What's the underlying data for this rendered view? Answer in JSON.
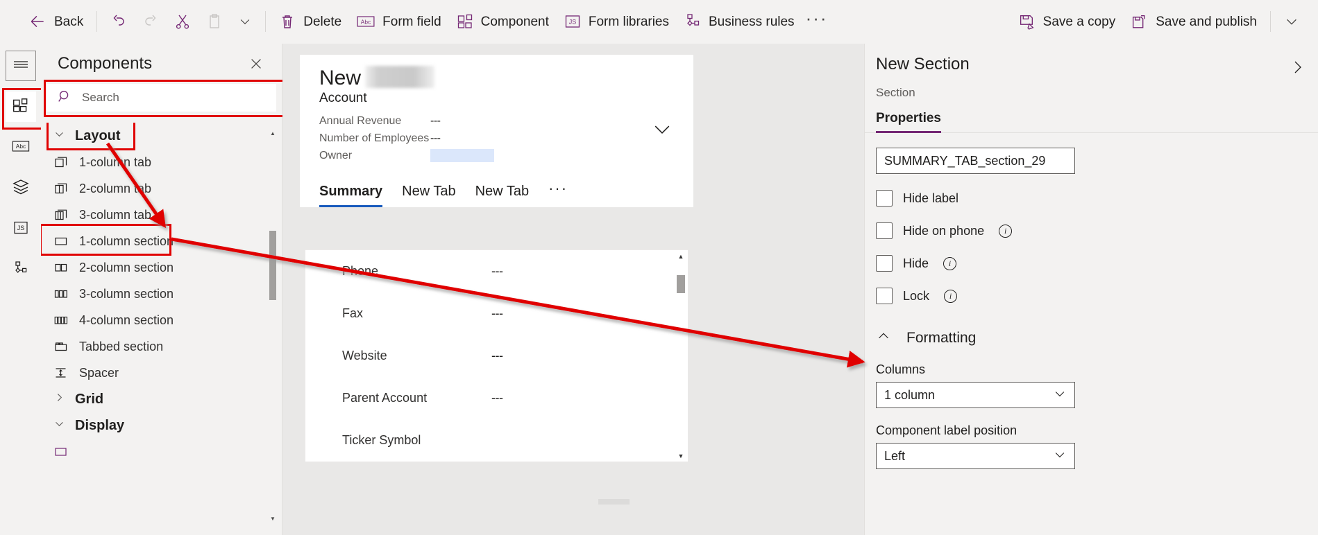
{
  "commandbar": {
    "back_label": "Back",
    "undo_icon": "undo-icon",
    "redo_icon": "redo-icon",
    "cut_icon": "cut-icon",
    "paste_icon": "paste-icon",
    "paste_chevron_icon": "chevron-down-icon",
    "delete_label": "Delete",
    "form_field_label": "Form field",
    "component_label": "Component",
    "form_libraries_label": "Form libraries",
    "business_rules_label": "Business rules",
    "overflow_label": "···",
    "save_a_copy_label": "Save a copy",
    "save_and_publish_label": "Save and publish",
    "save_chevron_icon": "chevron-down-icon"
  },
  "rail": {
    "items": [
      {
        "name": "hamburger-menu-icon",
        "label": ""
      },
      {
        "name": "components-icon",
        "label": ""
      },
      {
        "name": "table-columns-abc-icon",
        "label": "Abc"
      },
      {
        "name": "layers-icon",
        "label": ""
      },
      {
        "name": "javascript-icon",
        "label": "JS"
      },
      {
        "name": "business-rules-icon",
        "label": ""
      }
    ]
  },
  "panel": {
    "title": "Components",
    "close_icon": "close-icon",
    "search": {
      "placeholder": "Search",
      "value": ""
    },
    "groups": [
      {
        "label": "Layout",
        "expanded": true,
        "chevron": "chevron-down-icon",
        "items": [
          {
            "label": "1-column tab",
            "icon": "one-column-tab-icon",
            "selected": false
          },
          {
            "label": "2-column tab",
            "icon": "two-column-tab-icon",
            "selected": false
          },
          {
            "label": "3-column tab",
            "icon": "three-column-tab-icon",
            "selected": false
          },
          {
            "label": "1-column section",
            "icon": "one-column-section-icon",
            "selected": true
          },
          {
            "label": "2-column section",
            "icon": "two-column-section-icon",
            "selected": false
          },
          {
            "label": "3-column section",
            "icon": "three-column-section-icon",
            "selected": false
          },
          {
            "label": "4-column section",
            "icon": "four-column-section-icon",
            "selected": false
          },
          {
            "label": "Tabbed section",
            "icon": "tabbed-section-icon",
            "selected": false
          },
          {
            "label": "Spacer",
            "icon": "spacer-icon",
            "selected": false
          }
        ]
      },
      {
        "label": "Grid",
        "expanded": false,
        "chevron": "chevron-right-icon",
        "items": []
      },
      {
        "label": "Display",
        "expanded": true,
        "chevron": "chevron-down-icon",
        "items": []
      }
    ]
  },
  "canvas": {
    "record_title": "New",
    "record_subtitle": "Account",
    "header_fields": [
      {
        "label": "Annual Revenue",
        "value": "---"
      },
      {
        "label": "Number of Employees",
        "value": "---"
      },
      {
        "label": "Owner",
        "value": ""
      }
    ],
    "header_chevron_icon": "chevron-down-icon",
    "tabs": [
      {
        "label": "Summary",
        "active": true
      },
      {
        "label": "New Tab",
        "active": false
      },
      {
        "label": "New Tab",
        "active": false
      }
    ],
    "tabs_overflow": "···",
    "body_fields": [
      {
        "label": "Phone",
        "value": "---"
      },
      {
        "label": "Fax",
        "value": "---"
      },
      {
        "label": "Website",
        "value": "---"
      },
      {
        "label": "Parent Account",
        "value": "---"
      },
      {
        "label": "Ticker Symbol",
        "value": ""
      }
    ]
  },
  "properties": {
    "title": "New Section",
    "subtitle": "Section",
    "expand_icon": "chevron-right-icon",
    "tabs": [
      {
        "label": "Properties",
        "active": true
      }
    ],
    "name_field": {
      "value": "SUMMARY_TAB_section_29"
    },
    "checkboxes": [
      {
        "label": "Hide label",
        "checked": false,
        "info": false
      },
      {
        "label": "Hide on phone",
        "checked": false,
        "info": true
      },
      {
        "label": "Hide",
        "checked": false,
        "info": true
      },
      {
        "label": "Lock",
        "checked": false,
        "info": true
      }
    ],
    "formatting": {
      "title": "Formatting",
      "chevron": "chevron-up-icon",
      "columns_label": "Columns",
      "columns_value": "1 column",
      "label_position_label": "Component label position",
      "label_position_value": "Left",
      "chevron_icon": "chevron-down-icon"
    }
  },
  "annotation": {
    "color": "#e00000"
  }
}
